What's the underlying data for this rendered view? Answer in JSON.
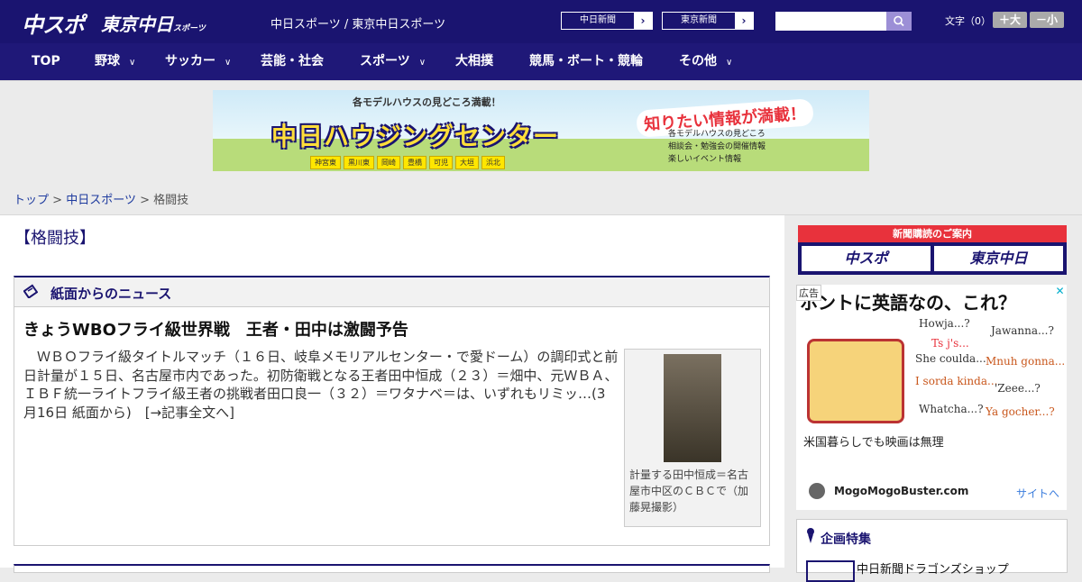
{
  "header": {
    "logo_chuspo": "中スポ",
    "logo_tokyo": "東京中日",
    "logo_tokyo_sub": "スポーツ",
    "site_title": "中日スポーツ / 東京中日スポーツ",
    "ext_links": [
      "中日新聞",
      "東京新聞"
    ],
    "search_placeholder": "",
    "font_label": "文字（0）",
    "font_bigger": "＋大",
    "font_smaller": "－小"
  },
  "nav": {
    "items": [
      "TOP",
      "野球",
      "サッカー",
      "芸能・社会",
      "スポーツ",
      "大相撲",
      "競馬・ボート・競輪",
      "その他"
    ]
  },
  "banner": {
    "top": "各モデルハウスの見どころ満載！",
    "main": "中日ハウジングセンター",
    "right": "知りたい情報が満載！",
    "list": [
      "各モデルハウスの見どころ",
      "相談会・勉強会の開催情報",
      "楽しいイベント情報"
    ],
    "cities": [
      "神宮東",
      "黒川東",
      "岡崎",
      "豊橋",
      "可児",
      "大垣",
      "浜北"
    ]
  },
  "breadcrumb": {
    "top": "トップ",
    "section": "中日スポーツ",
    "current": "格闘技",
    "sep": ">"
  },
  "category_title": "【格闘技】",
  "news": {
    "heading": "紙面からのニュース",
    "article_title": "きょうWBOフライ級世界戦　王者・田中は激闘予告",
    "article_body": "　ＷＢＯフライ級タイトルマッチ（１６日、岐阜メモリアルセンター・で愛ドーム）の調印式と前日計量が１５日、名古屋市内であった。初防衛戦となる王者田中恒成（２３）＝畑中、元ＷＢＡ、ＩＢＦ統一ライトフライ級王者の挑戦者田口良一（３２）＝ワタナベ＝は、いずれもリミッ…(3月16日 紙面から)　[→記事全文へ]",
    "photo_caption": "計量する田中恒成＝名古屋市中区のＣＢＣで（加藤晃撮影）"
  },
  "subscription": {
    "head": "新聞購読のご案内",
    "btn1": "中スポ",
    "btn2": "東京中日"
  },
  "ad": {
    "label": "広告",
    "close": "✕",
    "headline": "ホントに英語なの、これ？",
    "phrases": [
      "Howja...?",
      "Jawanna...?",
      "Ts j's...",
      "She coulda...",
      "Mnuh gonna...",
      "I sorda kinda...",
      "'Zeee...?",
      "Whatcha...?",
      "Ya gocher...?"
    ],
    "text": "米国暮らしでも映画は無理",
    "source": "MogoMogoBuster.com",
    "link": "サイトへ"
  },
  "kikaku": {
    "heading": "企画特集",
    "item": "中日新聞ドラゴンズショップ"
  },
  "colors": {
    "navy": "#1a1470",
    "red": "#e8323c"
  }
}
